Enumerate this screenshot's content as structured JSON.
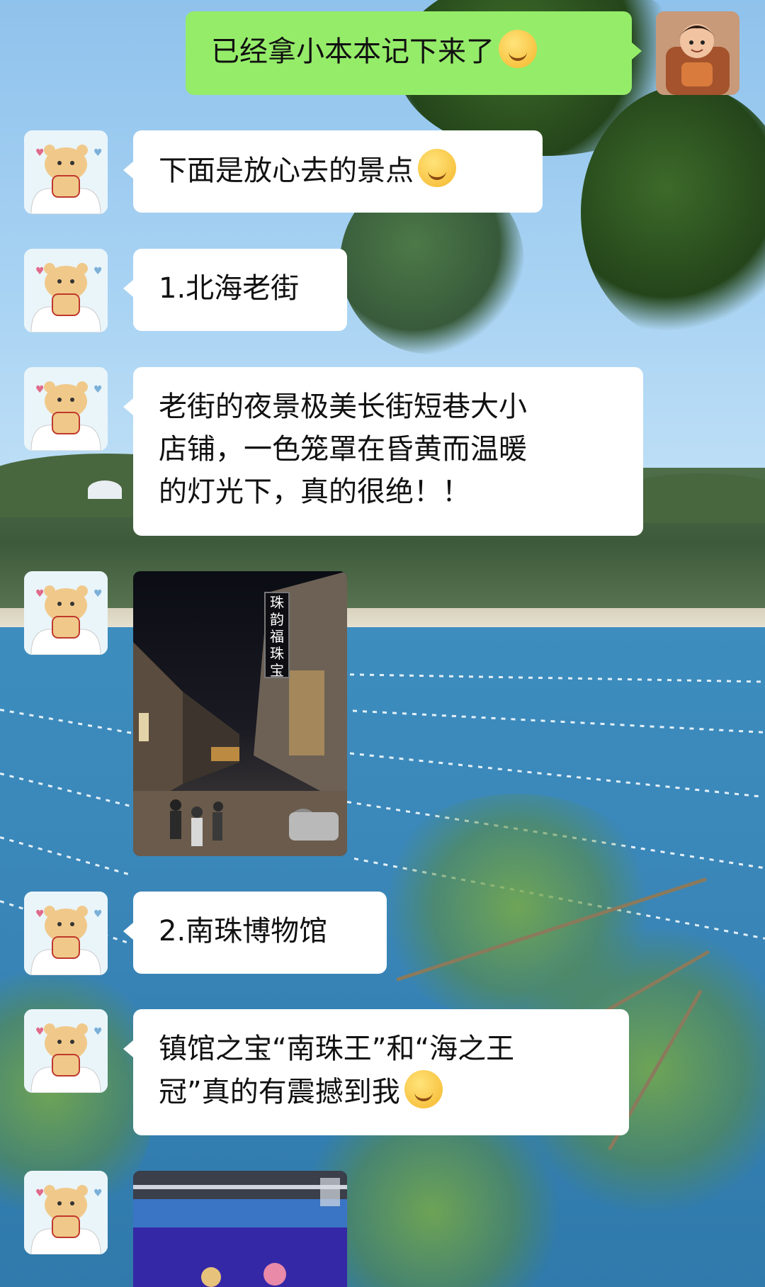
{
  "messages": [
    {
      "side": "right",
      "text": "已经拿小本本记下来了",
      "emoji": "grinning-face-emoji"
    },
    {
      "side": "left",
      "text": "下面是放心去的景点",
      "emoji": "face-with-hand-over-mouth-emoji"
    },
    {
      "side": "left",
      "text": "1.北海老街"
    },
    {
      "side": "left",
      "text": "老街的夜景极美长街短巷大小\n店铺，一色笼罩在昏黄而温暖\n的灯光下，真的很绝！！"
    },
    {
      "side": "left",
      "image": "night-old-street-photo",
      "sign_text": "珠韵福珠宝"
    },
    {
      "side": "left",
      "text": "2.南珠博物馆"
    },
    {
      "side": "left",
      "text": "镇馆之宝“南珠王”和“海之王\n冠”真的有震撼到我",
      "emoji": "hugging-face-emoji"
    },
    {
      "side": "left",
      "image": "museum-display-photo"
    }
  ],
  "colors": {
    "bubble_self": "#95ec69",
    "bubble_other": "#ffffff",
    "text": "#111111"
  },
  "icons": {
    "self_avatar": "cartoon-boy-avatar",
    "other_avatar": "cartoon-hamster-avatar"
  }
}
